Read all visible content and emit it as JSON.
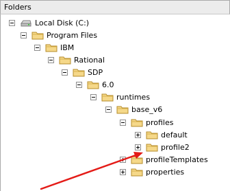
{
  "header": {
    "title": "Folders"
  },
  "tree": {
    "items": [
      {
        "label": "Local Disk (C:)",
        "icon": "drive-icon",
        "state": "expanded"
      },
      {
        "label": "Program Files",
        "icon": "folder-icon",
        "state": "expanded"
      },
      {
        "label": "IBM",
        "icon": "folder-icon",
        "state": "expanded"
      },
      {
        "label": "Rational",
        "icon": "folder-icon",
        "state": "expanded"
      },
      {
        "label": "SDP",
        "icon": "folder-icon",
        "state": "expanded"
      },
      {
        "label": "6.0",
        "icon": "folder-icon",
        "state": "expanded"
      },
      {
        "label": "runtimes",
        "icon": "folder-icon",
        "state": "expanded"
      },
      {
        "label": "base_v6",
        "icon": "folder-icon",
        "state": "expanded"
      },
      {
        "label": "profiles",
        "icon": "folder-icon",
        "state": "expanded"
      },
      {
        "label": "default",
        "icon": "folder-icon",
        "state": "collapsed"
      },
      {
        "label": "profile2",
        "icon": "folder-icon",
        "state": "collapsed"
      },
      {
        "label": "profileTemplates",
        "icon": "folder-icon",
        "state": "collapsed"
      },
      {
        "label": "properties",
        "icon": "folder-icon",
        "state": "collapsed"
      }
    ]
  },
  "annotation": {
    "icon": "arrow-annotation",
    "color": "#e41b17"
  },
  "colors": {
    "folder": "#f5d889",
    "folder_edge": "#b58b2a",
    "arrow": "#e41b17"
  }
}
